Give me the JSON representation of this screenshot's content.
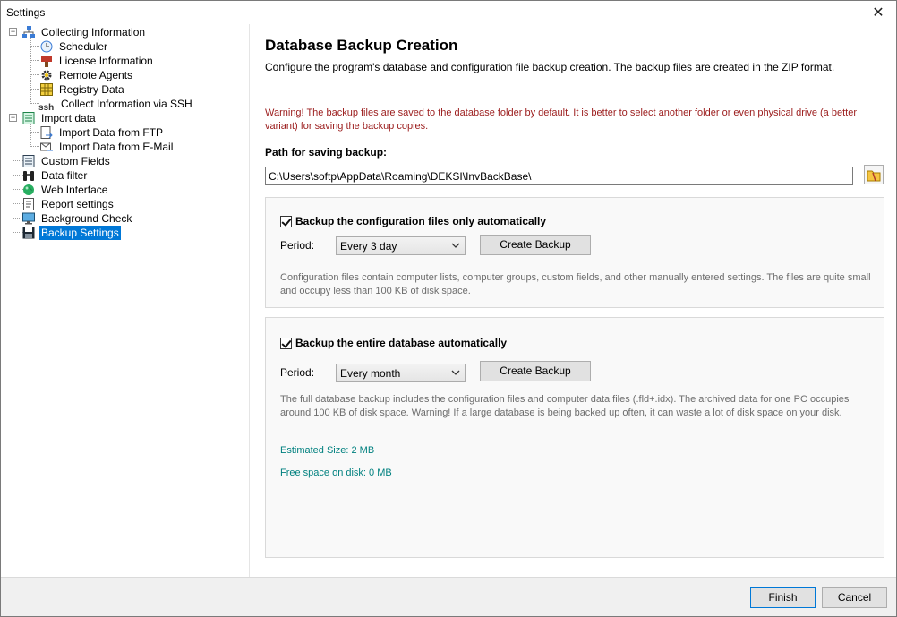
{
  "window": {
    "title": "Settings"
  },
  "tree": {
    "items": [
      {
        "label": "Collecting Information",
        "icon": "network-icon"
      },
      {
        "label": "Scheduler",
        "icon": "clock-icon"
      },
      {
        "label": "License Information",
        "icon": "license-icon"
      },
      {
        "label": "Remote Agents",
        "icon": "gear-icon"
      },
      {
        "label": "Registry Data",
        "icon": "grid-icon"
      },
      {
        "label": "Collect Information via SSH",
        "icon": "ssh-icon",
        "badge": "ssh"
      },
      {
        "label": "Import data",
        "icon": "import-icon"
      },
      {
        "label": "Import Data from FTP",
        "icon": "ftp-icon"
      },
      {
        "label": "Import Data from E-Mail",
        "icon": "email-import-icon"
      },
      {
        "label": "Custom Fields",
        "icon": "list-icon"
      },
      {
        "label": "Data filter",
        "icon": "binoculars-icon"
      },
      {
        "label": "Web Interface",
        "icon": "globe-icon"
      },
      {
        "label": "Report settings",
        "icon": "report-icon"
      },
      {
        "label": "Background Check",
        "icon": "monitor-icon"
      },
      {
        "label": "Backup Settings",
        "icon": "floppy-icon"
      }
    ]
  },
  "main": {
    "heading": "Database Backup Creation",
    "description": "Configure the program's database and configuration file backup creation. The backup files are created in the ZIP format.",
    "warning": "Warning! The backup files are saved to the database folder by default. It is better to select another folder or even physical drive (a better variant) for saving the backup copies.",
    "path_label": "Path for saving backup:",
    "path_value": "C:\\Users\\softp\\AppData\\Roaming\\DEKSI\\InvBackBase\\",
    "config_section": {
      "checkbox_label": "Backup the configuration files only automatically",
      "period_label": "Period:",
      "period_value": "Every 3 day",
      "button_label": "Create Backup",
      "note": "Configuration files contain computer lists, computer groups, custom fields, and other manually entered settings. The files are quite small and occupy less than 100 KB of disk space."
    },
    "database_section": {
      "checkbox_label": "Backup the entire database automatically",
      "period_label": "Period:",
      "period_value": "Every month",
      "button_label": "Create Backup",
      "note": "The full database backup includes the configuration files and computer data files (.fld+.idx). The archived data for one PC occupies around 100 KB of disk space. Warning! If a large database is being backed up often, it can waste a lot of disk space on your disk.",
      "estimated_size": "Estimated Size: 2 MB",
      "free_space": "Free space on disk: 0 MB"
    }
  },
  "footer": {
    "finish_label": "Finish",
    "cancel_label": "Cancel"
  },
  "colors": {
    "accent": "#0078d7",
    "warning": "#9b1c1c",
    "stat": "#00807f"
  }
}
